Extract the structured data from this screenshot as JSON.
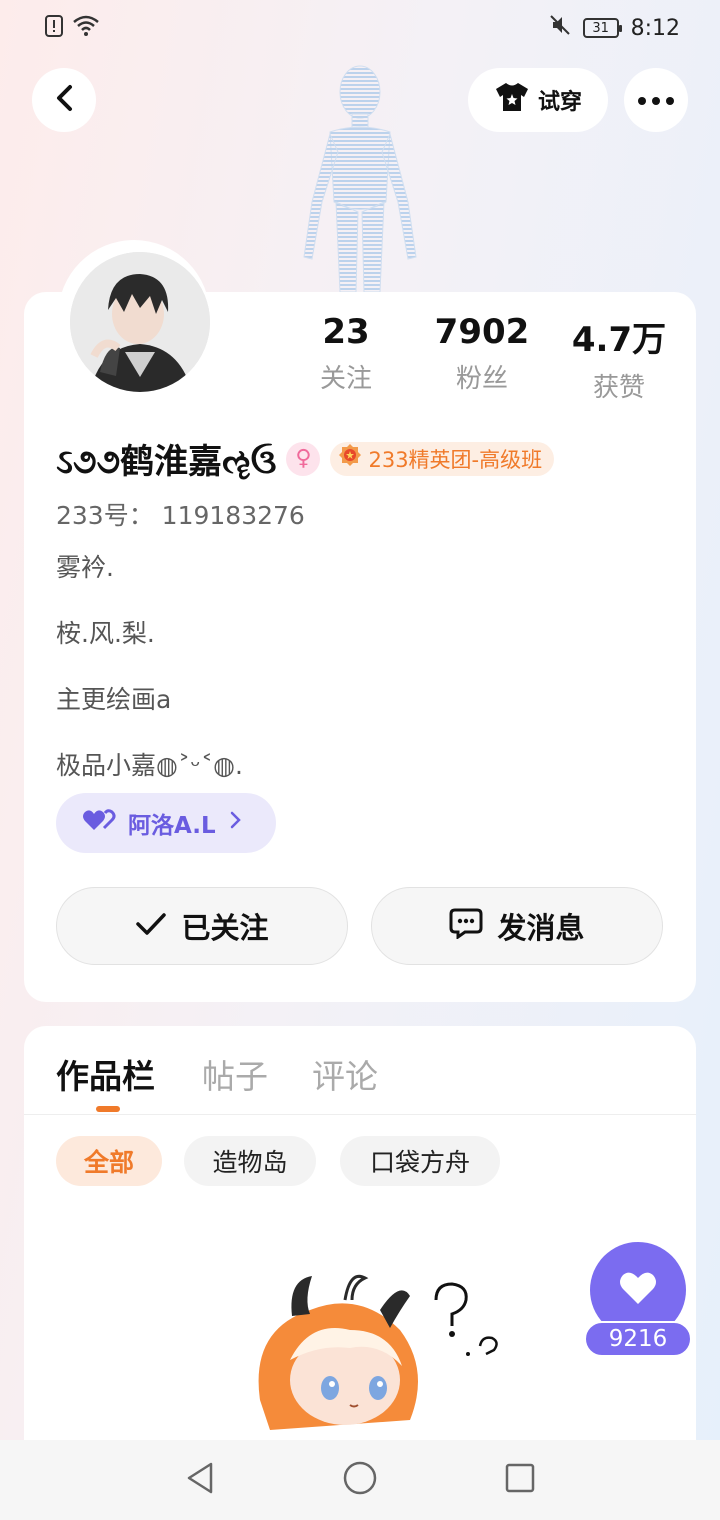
{
  "status_bar": {
    "time": "8:12",
    "battery": "31"
  },
  "header": {
    "try_on_label": "试穿"
  },
  "profile": {
    "stats": [
      {
        "value": "23",
        "label": "关注"
      },
      {
        "value": "7902",
        "label": "粉丝"
      },
      {
        "value": "4.7万",
        "label": "获赞"
      }
    ],
    "nickname": "ઽ૭૭鹤淮嘉ૡઉ",
    "gender_symbol": "♀",
    "group_badge": "233精英团-高级班",
    "uid": "233号：  119183276",
    "bio_lines": [
      "雾衿.",
      "桉.风.梨.",
      "主更绘画a",
      "极品小嘉◍˃ᵕ˂◍."
    ],
    "fan_club": "阿洛A.L",
    "follow_button": "已关注",
    "message_button": "发消息"
  },
  "content": {
    "tabs": [
      {
        "label": "作品栏",
        "active": true
      },
      {
        "label": "帖子",
        "active": false
      },
      {
        "label": "评论",
        "active": false
      }
    ],
    "filters": [
      {
        "label": "全部",
        "active": true
      },
      {
        "label": "造物岛",
        "active": false
      },
      {
        "label": "口袋方舟",
        "active": false
      }
    ]
  },
  "like_widget": {
    "count": "9216"
  },
  "colors": {
    "accent_orange": "#f07a2a",
    "accent_purple": "#7b6cf0"
  }
}
